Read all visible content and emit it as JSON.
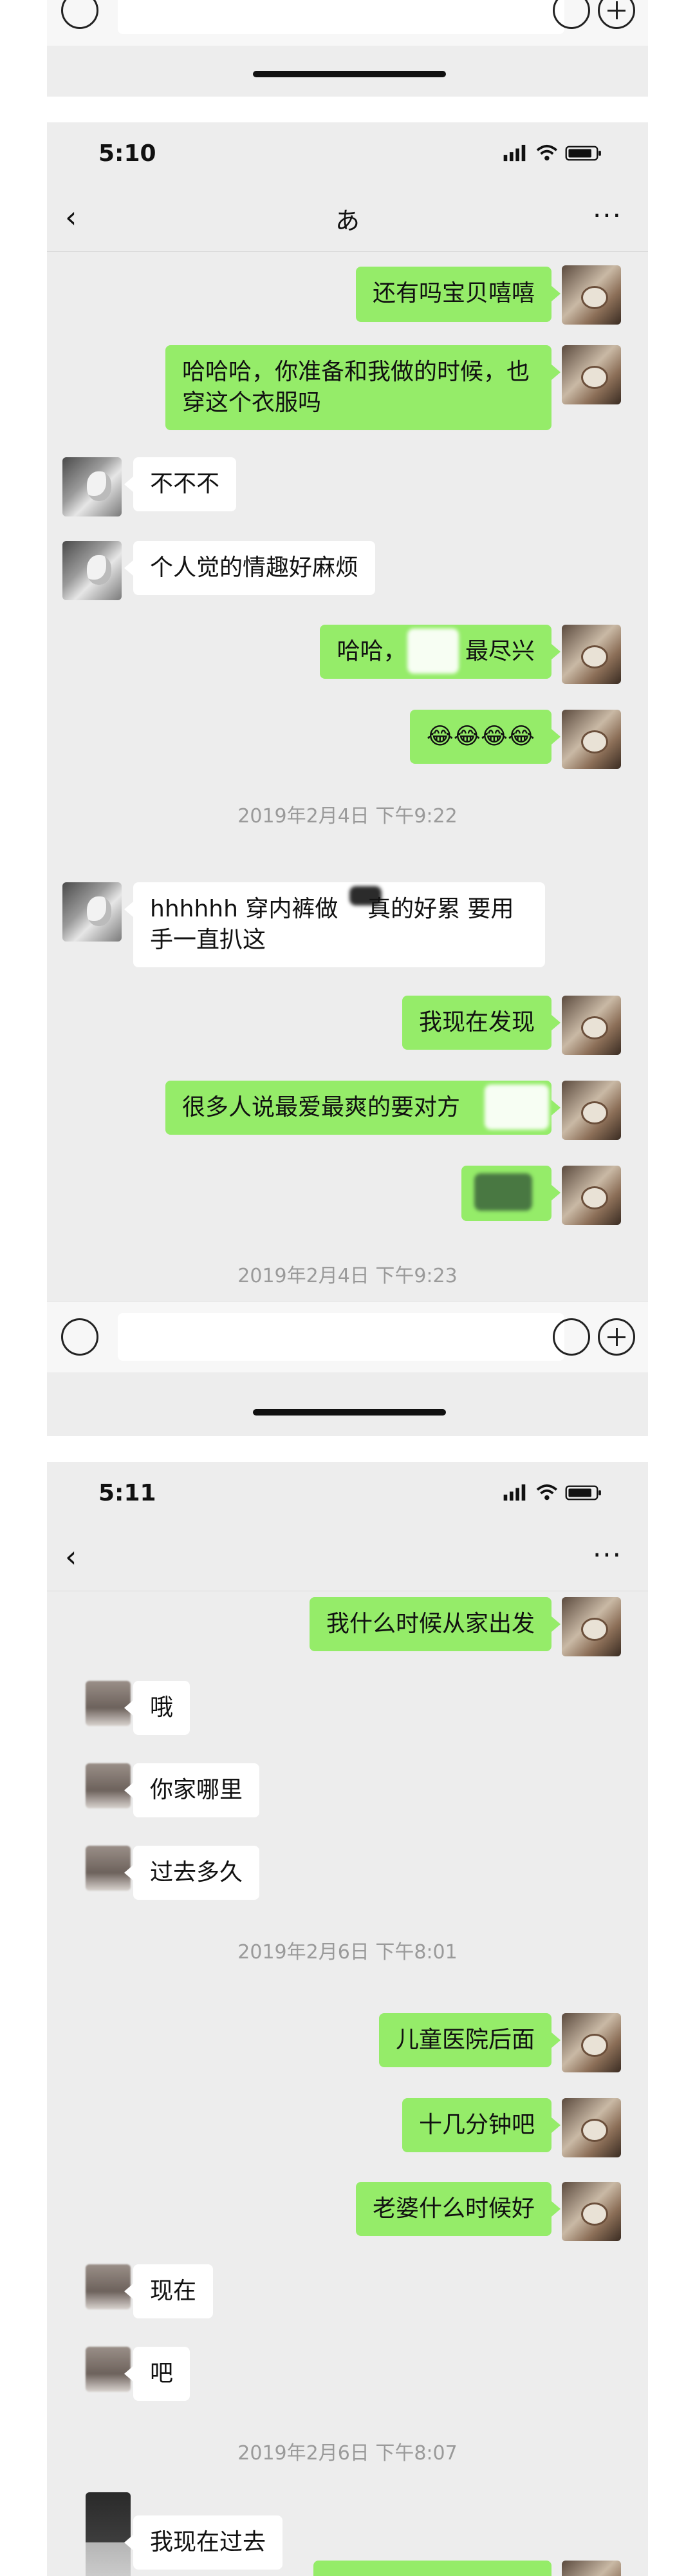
{
  "screen1": {
    "bottom_bar": {
      "input_value": ""
    }
  },
  "screen2": {
    "status": {
      "time": "5:10"
    },
    "nav": {
      "back": "‹",
      "title": "あ",
      "more": "···"
    },
    "messages": [
      {
        "side": "out",
        "text": "还有吗宝贝嘻嘻"
      },
      {
        "side": "out",
        "text": "哈哈哈，你准备和我做的时候，也\n穿这个衣服吗"
      },
      {
        "side": "in",
        "text": "不不不"
      },
      {
        "side": "in",
        "text": "个人觉的情趣好麻烦"
      },
      {
        "side": "out",
        "text": "哈哈，        最尽兴"
      },
      {
        "side": "out",
        "text": "😂😂😂😂"
      },
      {
        "side": "time",
        "text": "2019年2月4日 下午9:22"
      },
      {
        "side": "in",
        "text": "hhhhhh 穿内裤做    真的好累 要用\n手一直扒这"
      },
      {
        "side": "out",
        "text": "我现在发现"
      },
      {
        "side": "out",
        "text": "很多人说最爱最爽的要对方"
      },
      {
        "side": "out",
        "text": ""
      },
      {
        "side": "time",
        "text": "2019年2月4日 下午9:23"
      }
    ],
    "bottom_bar": {
      "input_value": ""
    }
  },
  "screen3": {
    "status": {
      "time": "5:11"
    },
    "nav": {
      "back": "‹",
      "title": "",
      "more": "···"
    },
    "messages": [
      {
        "side": "out",
        "text": "我什么时候从家出发"
      },
      {
        "side": "in",
        "text": "哦"
      },
      {
        "side": "in",
        "text": "你家哪里"
      },
      {
        "side": "in",
        "text": "过去多久"
      },
      {
        "side": "time",
        "text": "2019年2月6日 下午8:01"
      },
      {
        "side": "out",
        "text": "儿童医院后面"
      },
      {
        "side": "out",
        "text": "十几分钟吧"
      },
      {
        "side": "out",
        "text": "老婆什么时候好"
      },
      {
        "side": "in",
        "text": "现在"
      },
      {
        "side": "in",
        "text": "吧"
      },
      {
        "side": "time",
        "text": "2019年2月6日 下午8:07"
      },
      {
        "side": "in",
        "text": "我现在过去"
      }
    ]
  },
  "colors": {
    "chat_bg": "#ededed",
    "bubble_out": "#95ec69",
    "bubble_in": "#ffffff",
    "timestamp": "#9a9a9a"
  },
  "icons": [
    "location-arrow-icon",
    "signal-icon",
    "wifi-icon",
    "battery-icon",
    "back-chevron-icon",
    "more-icon",
    "voice-icon",
    "emoji-icon",
    "plus-icon"
  ]
}
